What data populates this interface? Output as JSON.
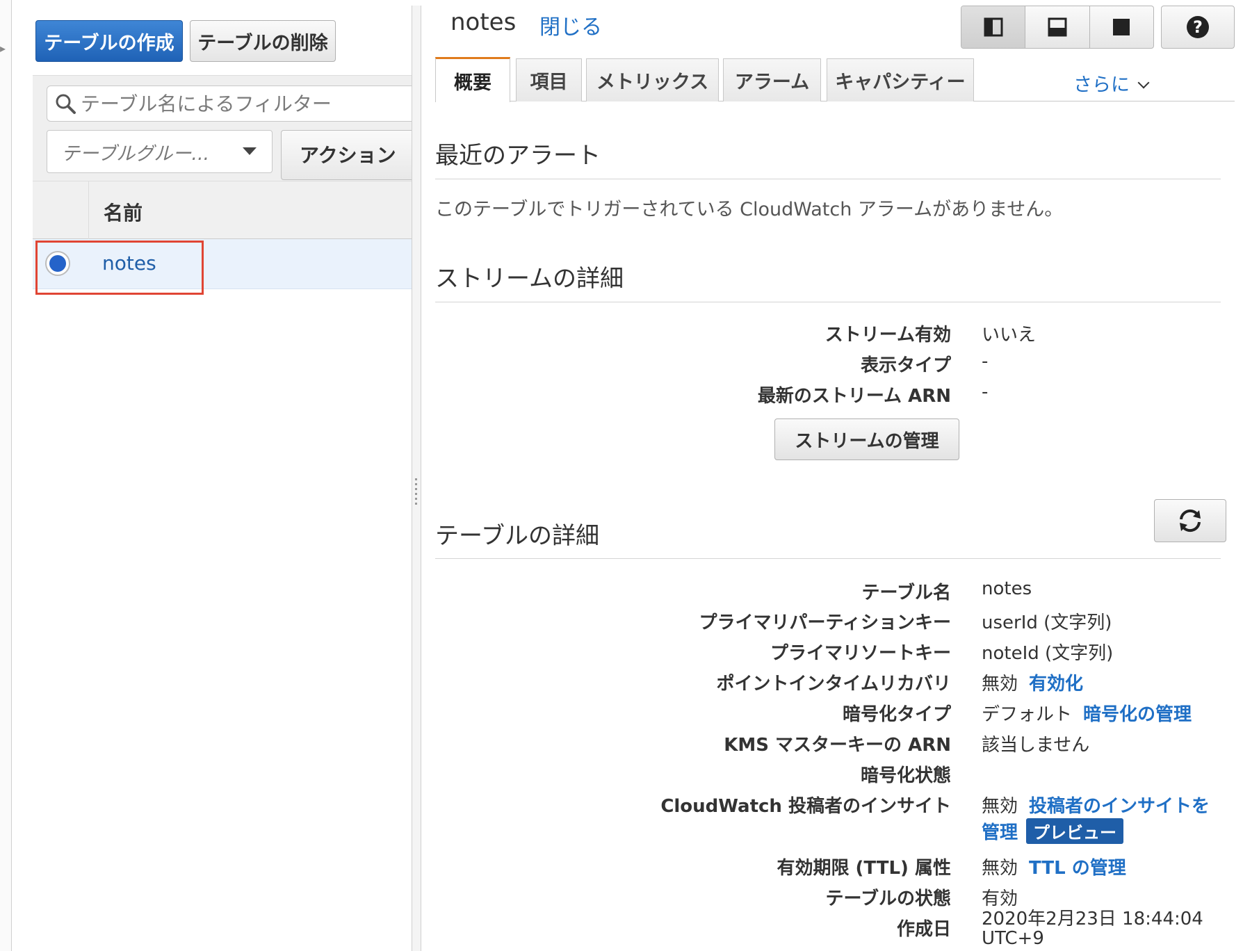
{
  "left": {
    "create_table": "テーブルの作成",
    "delete_table": "テーブルの削除",
    "search_placeholder": "テーブル名によるフィルター",
    "table_group": "テーブルグルー...",
    "actions": "アクション",
    "column_name": "名前",
    "rows": [
      {
        "name": "notes",
        "selected": true
      }
    ]
  },
  "right": {
    "title": "notes",
    "close": "閉じる",
    "layout_buttons": [
      "split-vertical-icon",
      "split-horizontal-icon",
      "full-panel-icon"
    ],
    "help_icon": "question-circle-icon",
    "tabs": [
      "概要",
      "項目",
      "メトリックス",
      "アラーム",
      "キャパシティー"
    ],
    "active_tab": "概要",
    "more": "さらに",
    "alerts": {
      "title": "最近のアラート",
      "message": "このテーブルでトリガーされている CloudWatch アラームがありません。"
    },
    "stream": {
      "title": "ストリームの詳細",
      "rows": [
        {
          "label": "ストリーム有効",
          "value": "いいえ"
        },
        {
          "label": "表示タイプ",
          "value": "-"
        },
        {
          "label": "最新のストリーム ARN",
          "value": "-"
        }
      ],
      "manage_button": "ストリームの管理"
    },
    "table_details": {
      "title": "テーブルの詳細",
      "refresh_icon": "refresh-icon",
      "rows": [
        {
          "label": "テーブル名",
          "value": "notes"
        },
        {
          "label": "プライマリパーティションキー",
          "value": "userId (文字列)"
        },
        {
          "label": "プライマリソートキー",
          "value": "noteId (文字列)"
        },
        {
          "label": "ポイントインタイムリカバリ",
          "value": "無効",
          "link": "有効化"
        },
        {
          "label": "暗号化タイプ",
          "value": "デフォルト",
          "link": "暗号化の管理"
        },
        {
          "label": "KMS マスターキーの ARN",
          "value": "該当しません"
        },
        {
          "label": "暗号化状態",
          "value": ""
        },
        {
          "label": "CloudWatch 投稿者のインサイト",
          "value": "無効",
          "link": "投稿者のインサイトを",
          "link2": "管理",
          "badge": "プレビュー"
        },
        {
          "label": "有効期限 (TTL) 属性",
          "value": "無効",
          "link": "TTL の管理"
        },
        {
          "label": "テーブルの状態",
          "value": "有効"
        },
        {
          "label": "作成日",
          "value": "2020年2月23日 18:44:04",
          "value2": "UTC+9"
        }
      ]
    }
  }
}
